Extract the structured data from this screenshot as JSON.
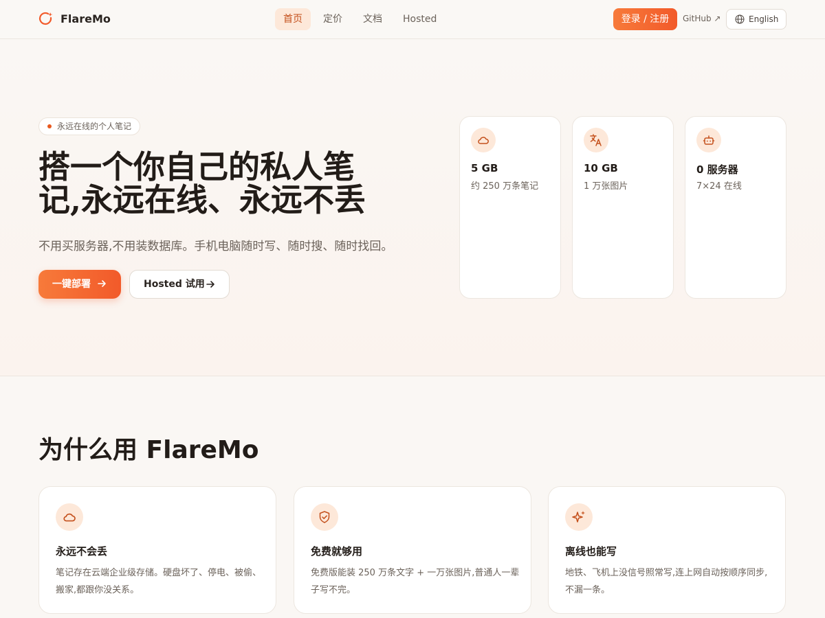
{
  "header": {
    "logo_text": "FlareMo",
    "nav": [
      {
        "label": "首页",
        "active": true
      },
      {
        "label": "定价",
        "active": false
      },
      {
        "label": "文档",
        "active": false
      },
      {
        "label": "Hosted",
        "active": false
      }
    ],
    "login_label": "登录 / 注册",
    "github_label": "GitHub ↗",
    "language_label": "English"
  },
  "hero": {
    "badge": "永远在线的个人笔记",
    "title": "搭一个你自己的私人笔记,永远在线、永远不丢",
    "subtitle": "不用买服务器,不用装数据库。手机电脑随时写、随时搜、随时找回。",
    "deploy_label": "一键部署",
    "hosted_label": "Hosted 试用"
  },
  "stats": [
    {
      "icon": "cloud-icon",
      "value": "5 GB",
      "desc": "约 250 万条笔记"
    },
    {
      "icon": "translate-icon",
      "value": "10 GB",
      "desc": "1 万张图片"
    },
    {
      "icon": "robot-icon",
      "value": "0 服务器",
      "desc": "7×24 在线"
    }
  ],
  "why": {
    "title": "为什么用 FlareMo",
    "features": [
      {
        "icon": "cloud-icon",
        "title": "永远不会丢",
        "desc": "笔记存在云端企业级存储。硬盘坏了、停电、被偷、搬家,都跟你没关系。"
      },
      {
        "icon": "shield-check-icon",
        "title": "免费就够用",
        "desc": "免费版能装 250 万条文字 + 一万张图片,普通人一辈子写不完。"
      },
      {
        "icon": "sparkles-icon",
        "title": "离线也能写",
        "desc": "地铁、飞机上没信号照常写,连上网自动按顺序同步,不漏一条。"
      }
    ]
  },
  "colors": {
    "accent": "#f25a2a",
    "accent_light": "#fde8d9",
    "background": "#faf7f4"
  }
}
